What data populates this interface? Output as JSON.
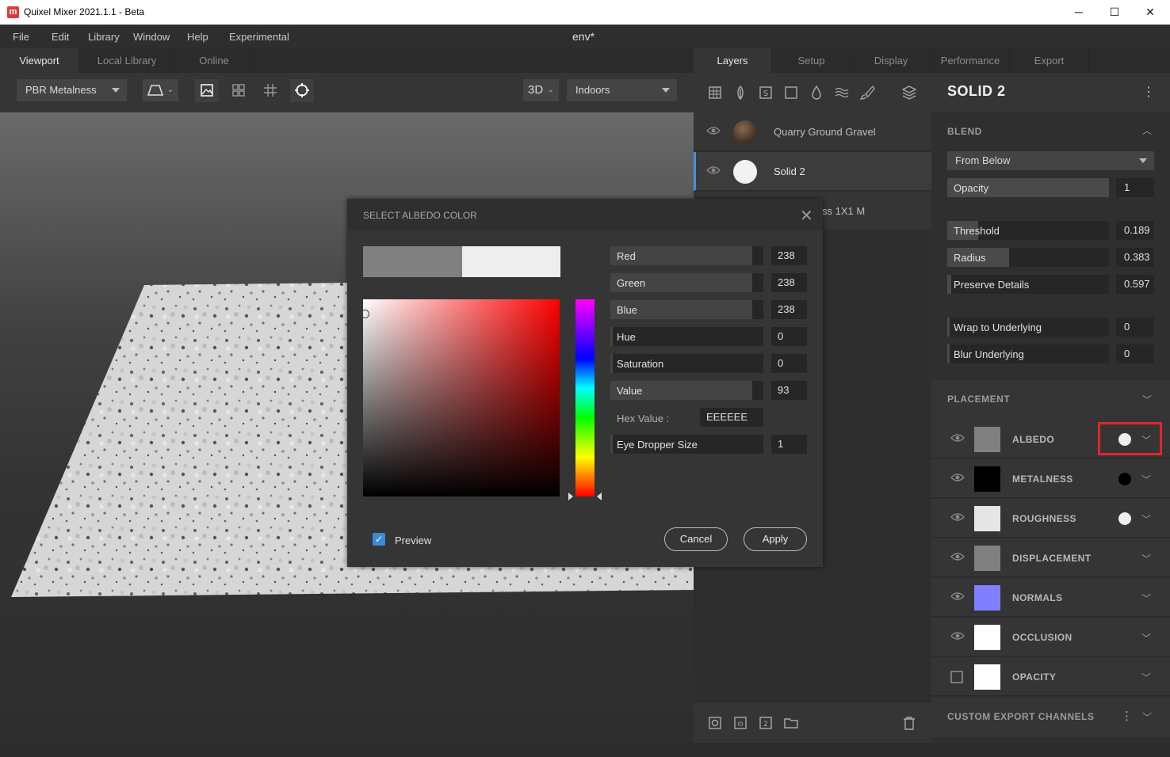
{
  "window": {
    "title": "Quixel Mixer 2021.1.1 - Beta",
    "logo_letter": "m",
    "minimize": "─",
    "maximize": "☐",
    "close": "✕"
  },
  "menu": {
    "items": [
      "File",
      "Edit",
      "Library",
      "Window",
      "Help",
      "Experimental"
    ],
    "document": "env*"
  },
  "left_tabs": [
    "Viewport",
    "Local Library",
    "Online"
  ],
  "right_tabs": [
    "Layers",
    "Setup",
    "Display",
    "Performance",
    "Export"
  ],
  "viewport_toolbar": {
    "shading_mode": "PBR Metalness",
    "view_mode": "3D",
    "environment": "Indoors"
  },
  "layers": [
    {
      "name": "Quarry Ground Gravel",
      "selected": false
    },
    {
      "name": "Solid 2",
      "selected": true
    },
    {
      "name": "ss 1X1 M",
      "selected": false
    }
  ],
  "properties": {
    "title": "SOLID 2",
    "blend": {
      "label": "BLEND",
      "mode": "From Below",
      "opacity_label": "Opacity",
      "opacity_value": "1",
      "params": [
        {
          "label": "Threshold",
          "value": "0.189",
          "fraction": 0.189
        },
        {
          "label": "Radius",
          "value": "0.383",
          "fraction": 0.383
        },
        {
          "label": "Preserve Details",
          "value": "0.597",
          "fraction": 0.597
        }
      ],
      "wrap_label": "Wrap to Underlying",
      "wrap_value": "0",
      "blur_label": "Blur Underlying",
      "blur_value": "0"
    },
    "placement_label": "PLACEMENT",
    "channels": [
      {
        "name": "ALBEDO",
        "swatch": "#808080",
        "dot": "#eeeeee",
        "visible": true
      },
      {
        "name": "METALNESS",
        "swatch": "#000000",
        "dot": "#000000",
        "visible": true
      },
      {
        "name": "ROUGHNESS",
        "swatch": "#e6e6e6",
        "dot": "#eeeeee",
        "visible": true
      },
      {
        "name": "DISPLACEMENT",
        "swatch": "#808080",
        "dot": "",
        "visible": true
      },
      {
        "name": "NORMALS",
        "swatch": "#8080ff",
        "dot": "",
        "visible": true
      },
      {
        "name": "OCCLUSION",
        "swatch": "#ffffff",
        "dot": "",
        "visible": true
      },
      {
        "name": "OPACITY",
        "swatch": "#ffffff",
        "dot": "",
        "visible": false
      }
    ],
    "custom_export_label": "CUSTOM EXPORT CHANNELS"
  },
  "dialog": {
    "title": "SELECT ALBEDO COLOR",
    "old_color": "#808080",
    "new_color": "#eeeeee",
    "fields": [
      {
        "label": "Red",
        "value": "238",
        "fraction": 0.93
      },
      {
        "label": "Green",
        "value": "238",
        "fraction": 0.93
      },
      {
        "label": "Blue",
        "value": "238",
        "fraction": 0.93
      },
      {
        "label": "Hue",
        "value": "0",
        "fraction": 0
      },
      {
        "label": "Saturation",
        "value": "0",
        "fraction": 0
      },
      {
        "label": "Value",
        "value": "93",
        "fraction": 0.93
      }
    ],
    "hex_label": "Hex Value :",
    "hex_value": "EEEEEE",
    "eyedropper_label": "Eye Dropper Size",
    "eyedropper_value": "1",
    "preview_label": "Preview",
    "preview_checked": true,
    "cancel_label": "Cancel",
    "apply_label": "Apply"
  },
  "colors": {
    "accent": "#3c8ad6",
    "highlight": "#e0252b"
  }
}
